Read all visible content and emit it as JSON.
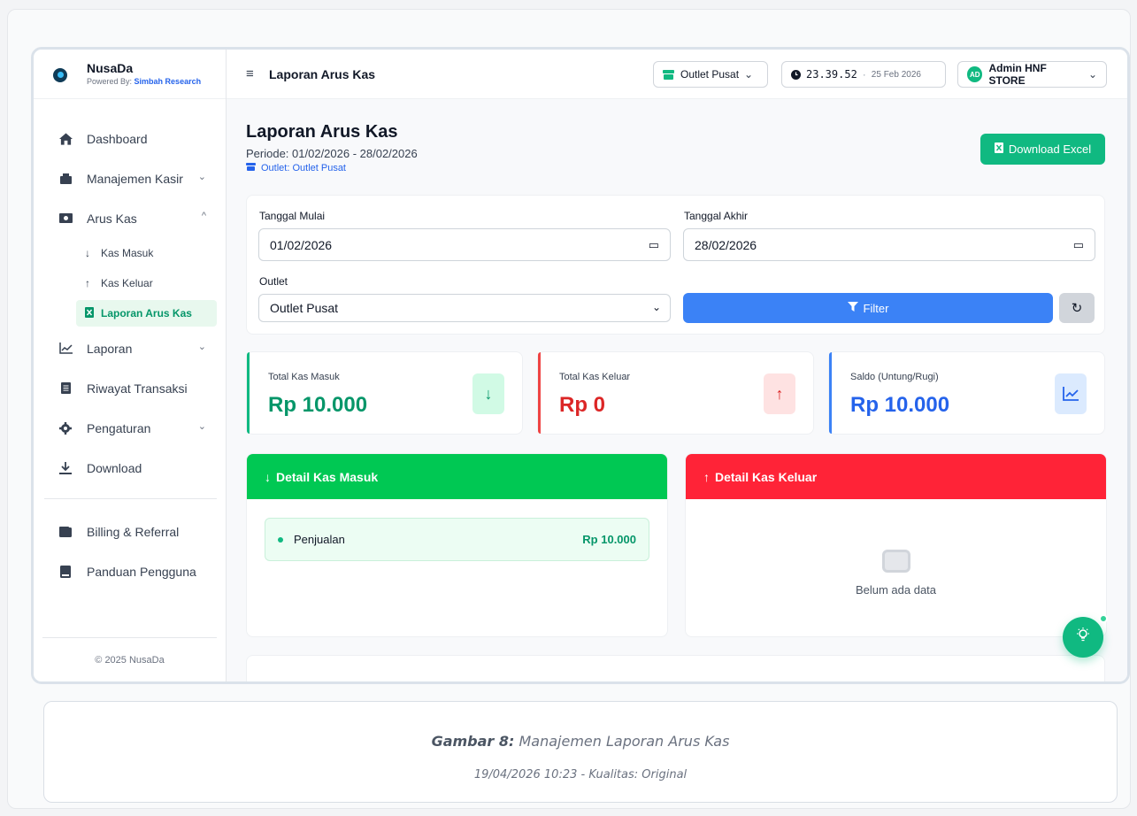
{
  "brand": {
    "name": "NusaDa",
    "powered_prefix": "Powered By:",
    "powered_by": "Simbah Research"
  },
  "sidebar": {
    "items": [
      {
        "label": "Dashboard",
        "icon": "home-icon"
      },
      {
        "label": "Manajemen Kasir",
        "icon": "cash-register-icon"
      },
      {
        "label": "Arus Kas",
        "icon": "money-icon"
      },
      {
        "label": "Laporan",
        "icon": "chart-line-icon"
      },
      {
        "label": "Riwayat Transaksi",
        "icon": "receipt-icon"
      },
      {
        "label": "Pengaturan",
        "icon": "gear-icon"
      },
      {
        "label": "Download",
        "icon": "download-icon"
      },
      {
        "label": "Billing & Referral",
        "icon": "wallet-icon"
      },
      {
        "label": "Panduan Pengguna",
        "icon": "book-icon"
      }
    ],
    "arus_kas_sub": [
      {
        "label": "Kas Masuk",
        "icon": "arrow-down-icon"
      },
      {
        "label": "Kas Keluar",
        "icon": "arrow-up-icon"
      },
      {
        "label": "Laporan Arus Kas",
        "icon": "excel-file-icon"
      }
    ],
    "footer": "© 2025 NusaDa"
  },
  "header": {
    "title": "Laporan Arus Kas",
    "outlet": "Outlet Pusat",
    "time": "23.39.52",
    "date": "25 Feb 2026",
    "user_initials": "AD",
    "user": "Admin HNF STORE"
  },
  "main": {
    "title": "Laporan Arus Kas",
    "periode": "Periode: 01/02/2026 - 28/02/2026",
    "outlet_label": "Outlet: Outlet Pusat",
    "download_label": "Download Excel"
  },
  "filter": {
    "start_label": "Tanggal Mulai",
    "start_value": "01/02/2026",
    "end_label": "Tanggal Akhir",
    "end_value": "28/02/2026",
    "outlet_label": "Outlet",
    "outlet_value": "Outlet Pusat",
    "filter_button": "Filter"
  },
  "stats": [
    {
      "label": "Total Kas Masuk",
      "value": "Rp 10.000",
      "color": "#10b981"
    },
    {
      "label": "Total Kas Keluar",
      "value": "Rp 0",
      "color": "#ef4444"
    },
    {
      "label": "Saldo (Untung/Rugi)",
      "value": "Rp 10.000",
      "color": "#3b82f6"
    }
  ],
  "detail_masuk": {
    "title": "Detail Kas Masuk",
    "rows": [
      {
        "label": "Penjualan",
        "amount": "Rp 10.000"
      }
    ]
  },
  "detail_keluar": {
    "title": "Detail Kas Keluar",
    "empty": "Belum ada data"
  },
  "caption": {
    "figure": "Gambar 8:",
    "title": "Manajemen Laporan Arus Kas",
    "sub": "19/04/2026 10:23 - Kualitas: Original"
  }
}
